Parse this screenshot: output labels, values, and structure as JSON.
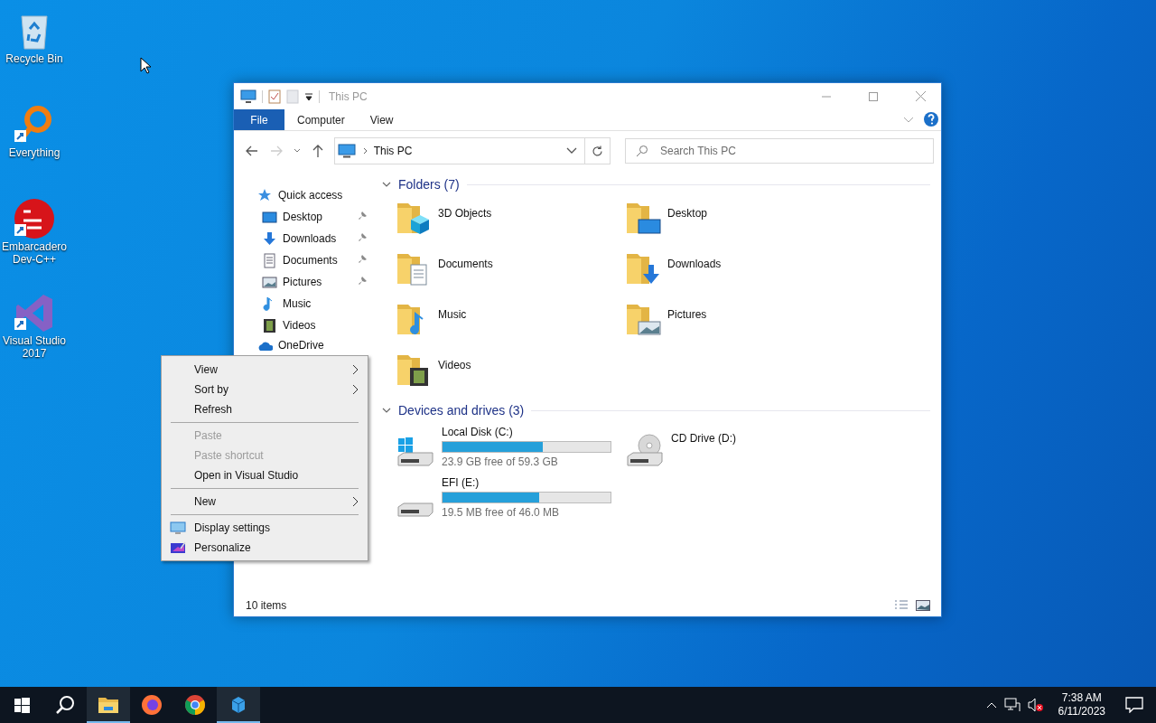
{
  "desktop_icons": [
    {
      "label": "Recycle Bin",
      "kind": "recycle",
      "shortcut": false
    },
    {
      "label": "Everything",
      "kind": "magnifier",
      "shortcut": true
    },
    {
      "label": "Embarcadero Dev-C++",
      "kind": "devcpp",
      "shortcut": true
    },
    {
      "label": "Visual Studio 2017",
      "kind": "vs",
      "shortcut": true
    }
  ],
  "explorer": {
    "title": "This PC",
    "ribbon_tabs": [
      {
        "label": "File",
        "kind": "file",
        "selected": false
      },
      {
        "label": "Computer",
        "kind": "tab",
        "selected": false
      },
      {
        "label": "View",
        "kind": "tab",
        "selected": false
      }
    ],
    "address": "This PC",
    "search_placeholder": "Search This PC",
    "nav_pane": [
      {
        "label": "Quick access",
        "kind": "star",
        "pinned": false
      },
      {
        "label": "Desktop",
        "kind": "desktop",
        "pinned": true
      },
      {
        "label": "Downloads",
        "kind": "download",
        "pinned": true
      },
      {
        "label": "Documents",
        "kind": "document",
        "pinned": true
      },
      {
        "label": "Pictures",
        "kind": "picture",
        "pinned": true
      },
      {
        "label": "Music",
        "kind": "music",
        "pinned": false
      },
      {
        "label": "Videos",
        "kind": "video",
        "pinned": false
      },
      {
        "label": "OneDrive",
        "kind": "cloud",
        "pinned": false
      }
    ],
    "folders": {
      "title": "Folders (7)",
      "expanded": true,
      "items": [
        {
          "label": "3D Objects",
          "kind": "cube"
        },
        {
          "label": "Desktop",
          "kind": "desktop"
        },
        {
          "label": "Documents",
          "kind": "document"
        },
        {
          "label": "Downloads",
          "kind": "download"
        },
        {
          "label": "Music",
          "kind": "music"
        },
        {
          "label": "Pictures",
          "kind": "picture"
        },
        {
          "label": "Videos",
          "kind": "video"
        }
      ]
    },
    "drives": {
      "title": "Devices and drives (3)",
      "expanded": true,
      "items": [
        {
          "label": "Local Disk (C:)",
          "kind": "system",
          "level": 0.597,
          "free": "23.9 GB free of 59.3 GB"
        },
        {
          "label": "CD Drive (D:)",
          "kind": "cd"
        },
        {
          "label": "EFI (E:)",
          "kind": "disk",
          "level": 0.576,
          "free": "19.5 MB free of 46.0 MB"
        }
      ]
    },
    "status": "10 items"
  },
  "context_menu": [
    {
      "kind": "item",
      "label": "View",
      "disabled": false,
      "submenu": true
    },
    {
      "kind": "item",
      "label": "Sort by",
      "disabled": false,
      "submenu": true
    },
    {
      "kind": "item",
      "label": "Refresh",
      "disabled": false,
      "submenu": false
    },
    {
      "kind": "separator"
    },
    {
      "kind": "item",
      "label": "Paste",
      "disabled": true,
      "submenu": false
    },
    {
      "kind": "item",
      "label": "Paste shortcut",
      "disabled": true,
      "submenu": false
    },
    {
      "kind": "item",
      "label": "Open in Visual Studio",
      "disabled": false,
      "submenu": false
    },
    {
      "kind": "separator"
    },
    {
      "kind": "item",
      "label": "New",
      "disabled": false,
      "submenu": true
    },
    {
      "kind": "separator"
    },
    {
      "kind": "display",
      "label": "Display settings",
      "disabled": false,
      "submenu": false
    },
    {
      "kind": "personalize",
      "label": "Personalize",
      "disabled": false,
      "submenu": false
    }
  ],
  "taskbar": {
    "apps": [
      {
        "kind": "start",
        "running": false
      },
      {
        "kind": "search",
        "running": false
      },
      {
        "kind": "explorer",
        "running": true
      },
      {
        "kind": "firefox",
        "running": false
      },
      {
        "kind": "chrome",
        "running": false
      },
      {
        "kind": "tool",
        "running": true
      }
    ],
    "time": "7:38 AM",
    "date": "6/11/2023"
  }
}
